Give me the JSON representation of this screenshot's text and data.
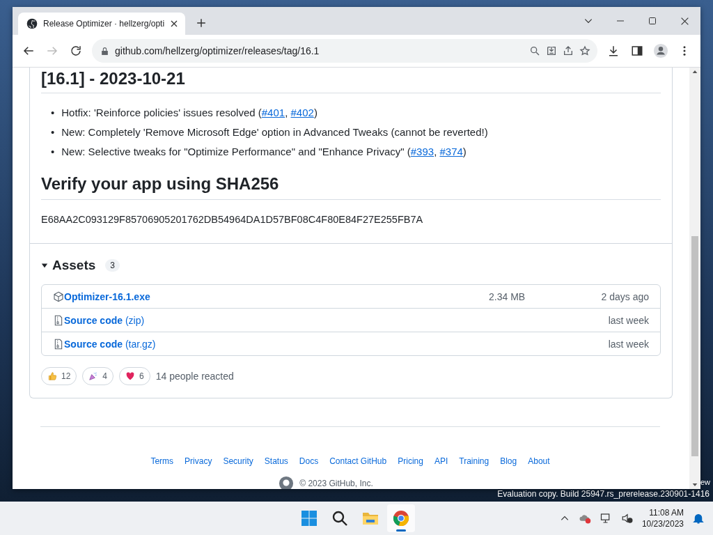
{
  "browser": {
    "tabs": [
      {
        "title": "Release Optimizer · hellzerg/opti",
        "selected": true
      }
    ],
    "url": "github.com/hellzerg/optimizer/releases/tag/16.1"
  },
  "release": {
    "heading": "[16.1] - 2023-10-21",
    "notes": [
      {
        "marker": "•",
        "parts": [
          {
            "kind": "text",
            "text": "Hotfix: 'Reinforce policies' issues resolved ("
          },
          {
            "kind": "link",
            "text": "#401"
          },
          {
            "kind": "text",
            "text": ", "
          },
          {
            "kind": "link",
            "text": "#402"
          },
          {
            "kind": "text",
            "text": ")"
          }
        ]
      },
      {
        "marker": "•",
        "parts": [
          {
            "kind": "text",
            "text": "New: Completely 'Remove Microsoft Edge' option in Advanced Tweaks (cannot be reverted!)"
          }
        ]
      },
      {
        "marker": "•",
        "parts": [
          {
            "kind": "text",
            "text": "New: Selective tweaks for \"Optimize Performance\" and \"Enhance Privacy\" ("
          },
          {
            "kind": "link",
            "text": "#393"
          },
          {
            "kind": "text",
            "text": ", "
          },
          {
            "kind": "link",
            "text": "#374"
          },
          {
            "kind": "text",
            "text": ")"
          }
        ]
      }
    ],
    "verify_heading": "Verify your app using SHA256",
    "hash": "E68AA2C093129F85706905201762DB54964DA1D57BF08C4F80E84F27E255FB7A",
    "assets": {
      "title": "Assets",
      "count": "3",
      "expanded": true,
      "items": [
        {
          "kind": "package",
          "name": "Optimizer-16.1.exe",
          "size": "2.34 MB",
          "date": "2 days ago"
        },
        {
          "kind": "archive",
          "name": "Source code",
          "suffix": "(zip)",
          "date": "last week"
        },
        {
          "kind": "archive",
          "name": "Source code",
          "suffix": "(tar.gz)",
          "date": "last week"
        }
      ]
    },
    "reactions": [
      {
        "kind": "thumbs-up",
        "count": "12"
      },
      {
        "kind": "party",
        "count": "4"
      },
      {
        "kind": "heart",
        "count": "6"
      }
    ],
    "reactions_summary": "14 people reacted"
  },
  "footer": {
    "links": [
      "Terms",
      "Privacy",
      "Security",
      "Status",
      "Docs",
      "Contact GitHub",
      "Pricing",
      "API",
      "Training",
      "Blog",
      "About"
    ],
    "copyright": "© 2023 GitHub, Inc."
  },
  "desktop": {
    "edge_text": "ew",
    "watermark": "Evaluation copy. Build 25947.rs_prerelease.230901-1416"
  },
  "taskbar": {
    "apps": [
      {
        "kind": "start",
        "active": false
      },
      {
        "kind": "search",
        "active": false
      },
      {
        "kind": "files",
        "active": false
      },
      {
        "kind": "browser",
        "active": true
      }
    ],
    "time": "11:08 AM",
    "date": "10/23/2023"
  }
}
